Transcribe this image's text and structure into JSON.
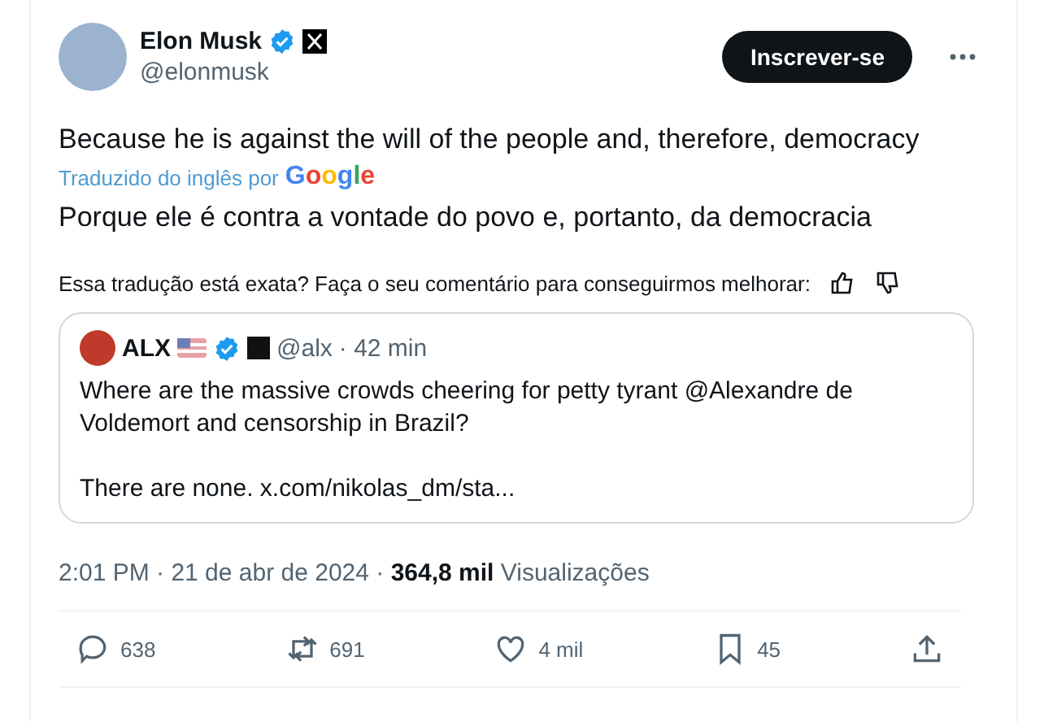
{
  "author": {
    "name": "Elon Musk",
    "handle": "@elonmusk",
    "verified": true
  },
  "follow_button": "Inscrever-se",
  "text": "Because he is against the will of the people and, therefore, democracy",
  "translated_by": "Traduzido do inglês por",
  "google": "Google",
  "translation": "Porque ele é contra a vontade do povo e, portanto, da democracia",
  "feedback": "Essa tradução está exata? Faça o seu comentário para conseguirmos melhorar:",
  "quote": {
    "name": "ALX",
    "verified": true,
    "handle": "@alx",
    "time": "· 42 min",
    "lines": [
      "Where are the massive crowds cheering for petty tyrant @Alexandre de Voldemort and censorship in Brazil?",
      "There are none. x.com/nikolas_dm/sta..."
    ]
  },
  "timestamp": "2:01 PM · 21 de abr de 2024 ·",
  "views": "364,8 mil",
  "views_label": "Visualizações",
  "actions": [
    {
      "kind": "reply",
      "count": "638"
    },
    {
      "kind": "repost",
      "count": "691"
    },
    {
      "kind": "like",
      "count": "4 mil"
    },
    {
      "kind": "bookmark",
      "count": "45"
    },
    {
      "kind": "share"
    }
  ]
}
